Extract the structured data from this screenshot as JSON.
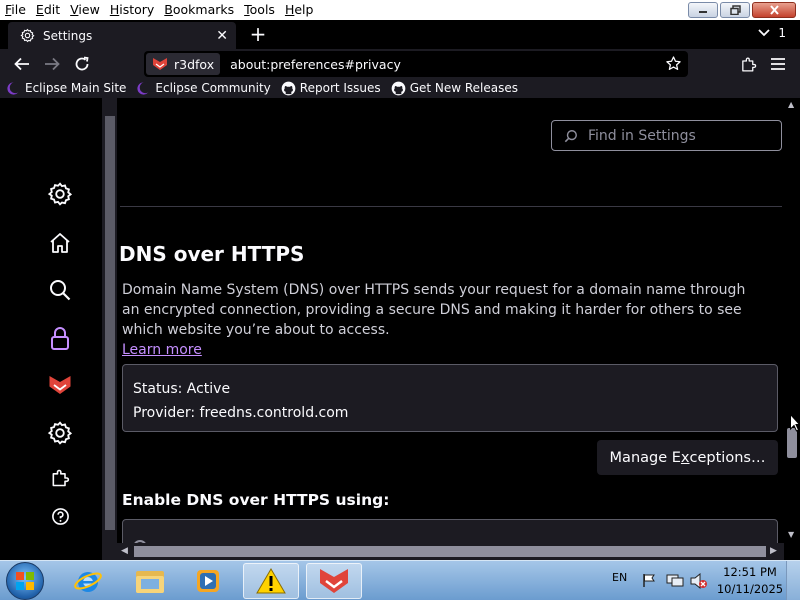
{
  "menu": {
    "items": [
      {
        "u": "F",
        "rest": "ile"
      },
      {
        "u": "E",
        "rest": "dit"
      },
      {
        "u": "V",
        "rest": "iew"
      },
      {
        "u": "H",
        "rest": "istory"
      },
      {
        "u": "B",
        "rest": "ookmarks"
      },
      {
        "u": "T",
        "rest": "ools"
      },
      {
        "u": "H",
        "rest": "elp"
      }
    ]
  },
  "tabs": {
    "active_title": "Settings",
    "new_tab_label": "+",
    "tab_count": "1"
  },
  "navbar": {
    "identity_label": "r3dfox",
    "url": "about:preferences#privacy"
  },
  "bookmarks": [
    {
      "label": "Eclipse Main Site",
      "icon": "eclipse-icon"
    },
    {
      "label": "Eclipse Community",
      "icon": "eclipse-icon"
    },
    {
      "label": "Report Issues",
      "icon": "github-icon"
    },
    {
      "label": "Get New Releases",
      "icon": "github-icon"
    }
  ],
  "sidebar": [
    {
      "name": "general",
      "icon": "gear-icon"
    },
    {
      "name": "home",
      "icon": "home-icon"
    },
    {
      "name": "search",
      "icon": "search-icon"
    },
    {
      "name": "privacy",
      "icon": "lock-icon",
      "selected": true
    },
    {
      "name": "r3dfox",
      "icon": "r3dfox-icon"
    },
    {
      "name": "more-settings",
      "icon": "gear-icon"
    },
    {
      "name": "extensions",
      "icon": "puzzle-icon"
    },
    {
      "name": "help",
      "icon": "help-icon"
    }
  ],
  "search": {
    "placeholder": "Find in Settings"
  },
  "dns": {
    "heading": "DNS over HTTPS",
    "description": "Domain Name System (DNS) over HTTPS sends your request for a domain name through an encrypted connection, providing a secure DNS and making it harder for others to see which website you’re about to access.",
    "learn_more": "Learn more",
    "status": "Status: Active",
    "provider": "Provider: freedns.controld.com",
    "manage_pre": "Manage E",
    "manage_u": "x",
    "manage_post": "ceptions…",
    "enable_heading": "Enable DNS over HTTPS using:"
  },
  "taskbar": {
    "language": "EN",
    "time": "12:51 PM",
    "date": "10/11/2025"
  },
  "colors": {
    "accent": "#c58fff",
    "background": "#000000",
    "surface": "#1c1b22"
  }
}
